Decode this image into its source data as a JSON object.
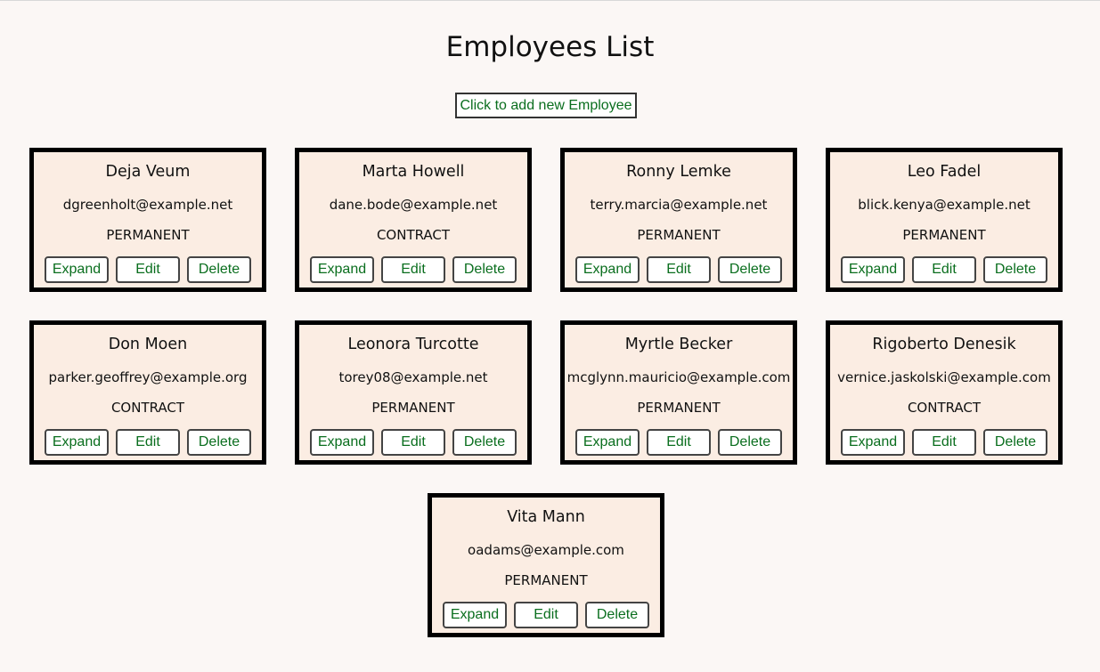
{
  "page": {
    "title": "Employees List",
    "add_button_label": "Click to add new Employee"
  },
  "actions": {
    "expand": "Expand",
    "edit": "Edit",
    "delete": "Delete"
  },
  "employees": [
    {
      "name": "Deja Veum",
      "email": "dgreenholt@example.net",
      "type": "PERMANENT"
    },
    {
      "name": "Marta Howell",
      "email": "dane.bode@example.net",
      "type": "CONTRACT"
    },
    {
      "name": "Ronny Lemke",
      "email": "terry.marcia@example.net",
      "type": "PERMANENT"
    },
    {
      "name": "Leo Fadel",
      "email": "blick.kenya@example.net",
      "type": "PERMANENT"
    },
    {
      "name": "Don Moen",
      "email": "parker.geoffrey@example.org",
      "type": "CONTRACT"
    },
    {
      "name": "Leonora Turcotte",
      "email": "torey08@example.net",
      "type": "PERMANENT"
    },
    {
      "name": "Myrtle Becker",
      "email": "mcglynn.mauricio@example.com",
      "type": "PERMANENT"
    },
    {
      "name": "Rigoberto Denesik",
      "email": "vernice.jaskolski@example.com",
      "type": "CONTRACT"
    },
    {
      "name": "Vita Mann",
      "email": "oadams@example.com",
      "type": "PERMANENT"
    }
  ],
  "colors": {
    "background": "#fbf7f5",
    "card_background": "#fbede3",
    "button_text": "#0a6e1e"
  }
}
